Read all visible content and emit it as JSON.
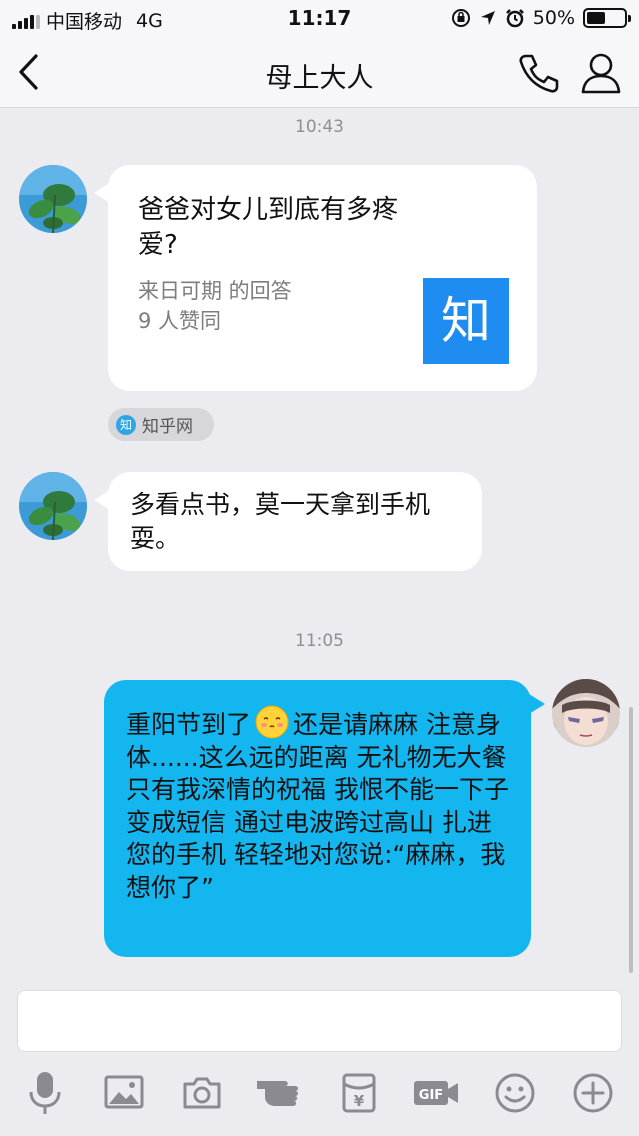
{
  "status_bar": {
    "carrier": "中国移动",
    "network": "4G",
    "time": "11:17",
    "battery_percent": "50%",
    "battery_level": 0.5
  },
  "nav": {
    "title": "母上大人"
  },
  "chat": {
    "timestamp1": "10:43",
    "card": {
      "title": "爸爸对女儿到底有多疼爱?",
      "author_line": "来日可期 的回答",
      "likes_line": "9 人赞同",
      "logo_char": "知",
      "source_icon_char": "知",
      "source_label": "知乎网"
    },
    "message2": "多看点书，莫一天拿到手机耍。",
    "timestamp2": "11:05",
    "message3_part1": "重阳节到了",
    "message3_part2": "还是请麻麻 注意身体......这么远的距离   无礼物无大餐    只有我深情的祝福   我恨不能一下子变成短信    通过电波跨过高山    扎进您的手机   轻轻地对您说:“麻麻，我想你了”"
  },
  "toolbar": {
    "items": [
      "mic-icon",
      "image-icon",
      "camera-icon",
      "poke-icon",
      "red-packet-icon",
      "gif-icon",
      "emoji-icon",
      "add-icon"
    ],
    "gif_label": "GIF",
    "red_packet_symbol": "¥"
  },
  "colors": {
    "sent_bubble": "#14b6f0",
    "zhihu_blue": "#1e8cf0"
  }
}
